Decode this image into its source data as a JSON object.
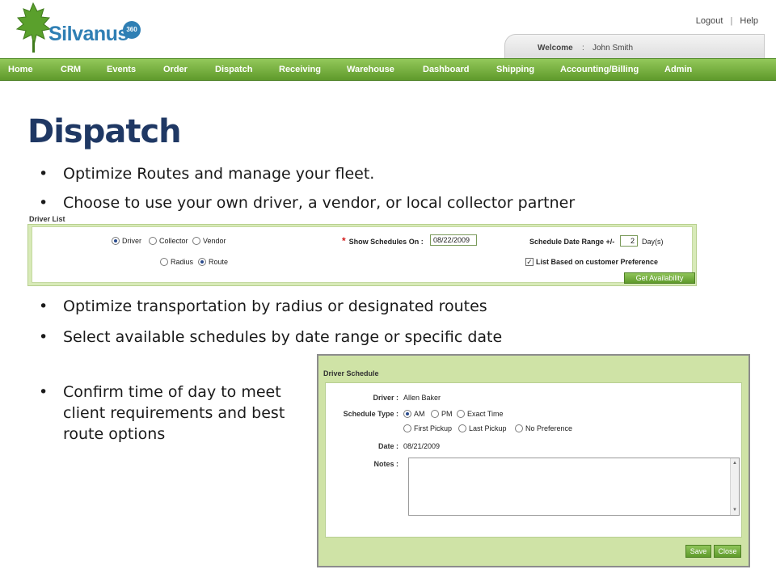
{
  "header": {
    "logo_text": "Silvanus",
    "logo_badge": "360",
    "logout": "Logout",
    "separator": "|",
    "help": "Help",
    "welcome_label": "Welcome",
    "welcome_colon": ":",
    "welcome_user": "John Smith"
  },
  "nav": {
    "items": [
      "Home",
      "CRM",
      "Events",
      "Order",
      "Dispatch",
      "Receiving",
      "Warehouse",
      "Dashboard",
      "Shipping",
      "Accounting/Billing",
      "Admin"
    ]
  },
  "slide": {
    "title": "Dispatch",
    "bullet_glyph": "•",
    "bullets": [
      "Optimize Routes and manage your fleet.",
      "Choose to use your own driver, a vendor, or local collector partner",
      "Optimize transportation by radius or designated routes",
      "Select available schedules by date range or specific date",
      "Confirm time of day to meet client requirements and best route options"
    ]
  },
  "driver_list": {
    "section_label": "Driver List",
    "type_options": [
      {
        "label": "Driver",
        "selected": true
      },
      {
        "label": "Collector",
        "selected": false
      },
      {
        "label": "Vendor",
        "selected": false
      }
    ],
    "mode_options": [
      {
        "label": "Radius",
        "selected": false
      },
      {
        "label": "Route",
        "selected": true
      }
    ],
    "required_mark": "*",
    "show_schedules_label": "Show Schedules On :",
    "show_schedules_value": "08/22/2009",
    "date_range_label": "Schedule Date Range +/-",
    "date_range_value": "2",
    "date_range_unit": "Day(s)",
    "preference_label": "List Based on customer Preference",
    "preference_checked": true,
    "check_glyph": "✓",
    "get_availability": "Get Availability"
  },
  "driver_schedule": {
    "title": "Driver Schedule",
    "driver_label": "Driver :",
    "driver_value": "Allen Baker",
    "schedule_type_label": "Schedule Type :",
    "schedule_options": [
      {
        "label": "AM",
        "selected": true
      },
      {
        "label": "PM",
        "selected": false
      },
      {
        "label": "Exact Time",
        "selected": false
      },
      {
        "label": "First Pickup",
        "selected": false
      },
      {
        "label": "Last Pickup",
        "selected": false
      },
      {
        "label": "No Preference",
        "selected": false
      }
    ],
    "date_label": "Date :",
    "date_value": "08/21/2009",
    "notes_label": "Notes :",
    "notes_value": "",
    "save": "Save",
    "close": "Close",
    "scroll_up_glyph": "▲",
    "scroll_down_glyph": "▼"
  },
  "colors": {
    "title_blue": "#1f3864",
    "nav_green": "#6ea93a",
    "panel_green": "#d8eab8",
    "logo_blue": "#2f7fb4",
    "logo_leaf": "#5aa02c"
  }
}
